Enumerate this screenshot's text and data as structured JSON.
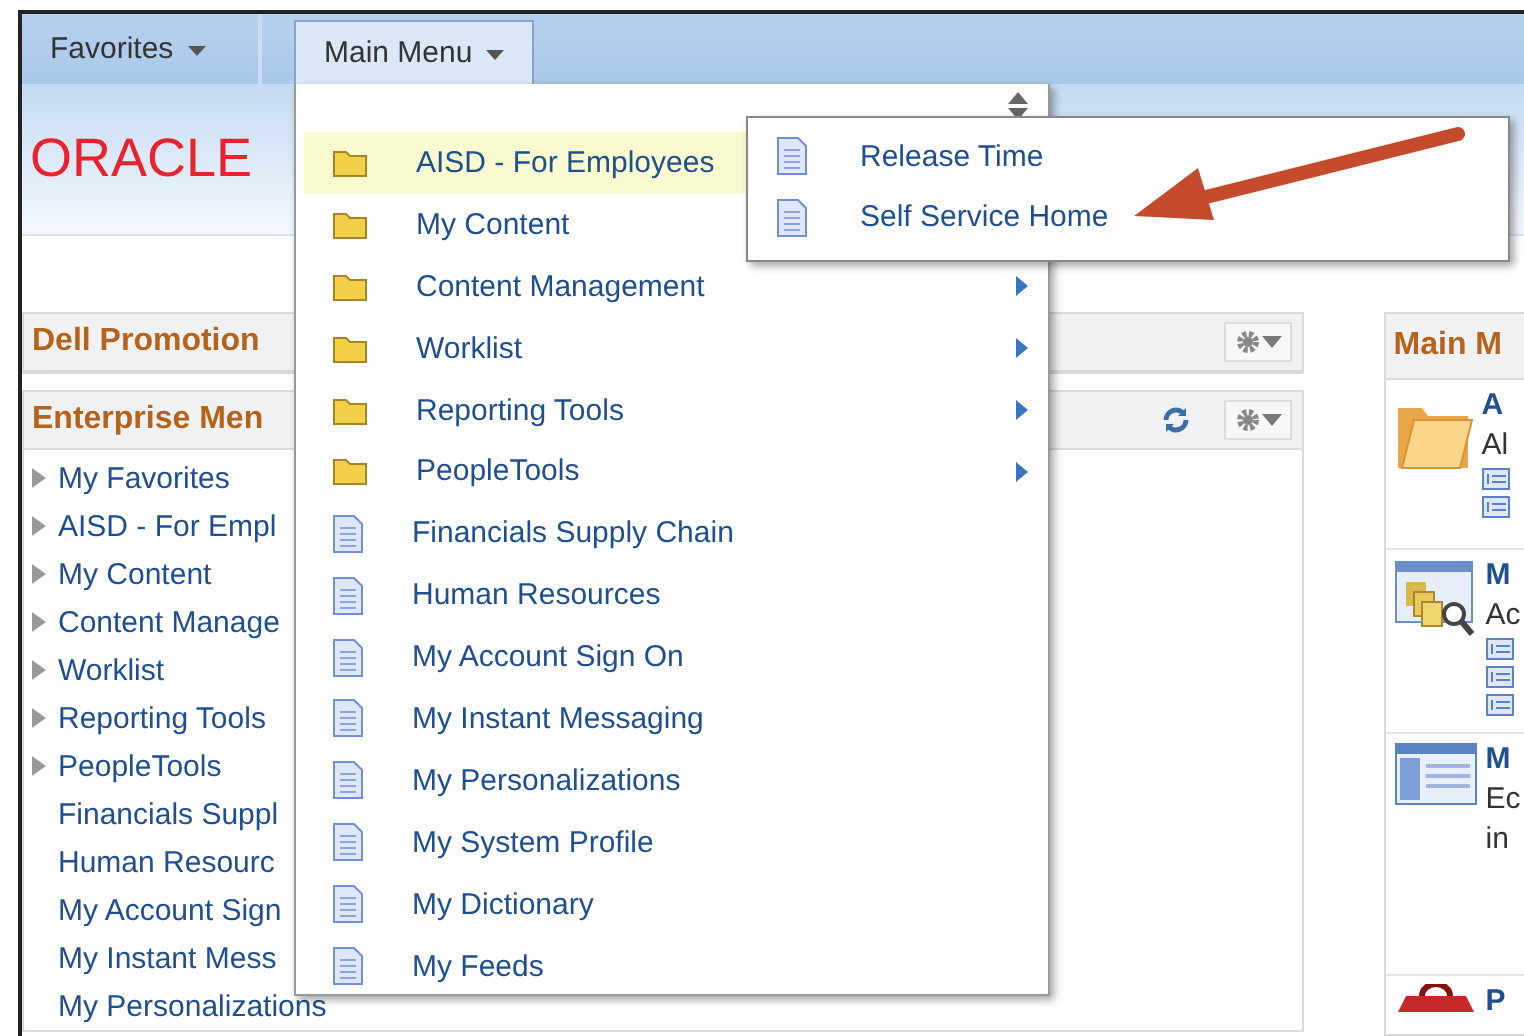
{
  "nav": {
    "tabs": [
      {
        "label": "Favorites",
        "selected": false
      },
      {
        "label": "Main Menu",
        "selected": true
      }
    ]
  },
  "header": {
    "logo": "ORACLE"
  },
  "pagelets": [
    {
      "title": "Dell Promotion",
      "refresh": false
    },
    {
      "title": "Enterprise Men",
      "refresh": true,
      "items": [
        {
          "label": "My Favorites",
          "expandable": true
        },
        {
          "label": "AISD - For Empl",
          "expandable": true
        },
        {
          "label": "My Content",
          "expandable": true
        },
        {
          "label": "Content Manage",
          "expandable": true
        },
        {
          "label": "Worklist",
          "expandable": true
        },
        {
          "label": "Reporting Tools",
          "expandable": true
        },
        {
          "label": "PeopleTools",
          "expandable": true
        },
        {
          "label": "Financials Suppl",
          "expandable": false
        },
        {
          "label": "Human Resourc",
          "expandable": false
        },
        {
          "label": "My Account Sign",
          "expandable": false
        },
        {
          "label": "My Instant Mess",
          "expandable": false
        },
        {
          "label": "My Personalizations",
          "expandable": false
        }
      ]
    }
  ],
  "main_menu_panel": {
    "title": "Main M",
    "sections": [
      {
        "kind": "folder",
        "title": "A",
        "lines": [
          {
            "kind": "text",
            "text": "Al"
          },
          {
            "kind": "link"
          },
          {
            "kind": "link"
          }
        ]
      },
      {
        "kind": "search-docs",
        "title": "M",
        "lines": [
          {
            "kind": "text",
            "text": "Ac"
          },
          {
            "kind": "link"
          },
          {
            "kind": "link"
          },
          {
            "kind": "link"
          }
        ]
      },
      {
        "kind": "window",
        "title": "M",
        "lines": [
          {
            "kind": "text",
            "text": "Ec"
          },
          {
            "kind": "text",
            "text": "in"
          }
        ]
      },
      {
        "kind": "toolbox",
        "title": "P"
      }
    ]
  },
  "dropdown": {
    "items": [
      {
        "label": "AISD - For Employees",
        "kind": "folder",
        "selected": true,
        "submenu": false
      },
      {
        "label": "My Content",
        "kind": "folder",
        "selected": false,
        "submenu": false
      },
      {
        "label": "Content Management",
        "kind": "folder",
        "selected": false,
        "submenu": true
      },
      {
        "label": "Worklist",
        "kind": "folder",
        "selected": false,
        "submenu": true
      },
      {
        "label": "Reporting Tools",
        "kind": "folder",
        "selected": false,
        "submenu": true
      },
      {
        "label": "PeopleTools",
        "kind": "folder",
        "selected": false,
        "submenu": true
      },
      {
        "label": "Financials Supply Chain",
        "kind": "page",
        "selected": false,
        "submenu": false
      },
      {
        "label": "Human Resources",
        "kind": "page",
        "selected": false,
        "submenu": false
      },
      {
        "label": "My Account Sign On",
        "kind": "page",
        "selected": false,
        "submenu": false
      },
      {
        "label": "My Instant Messaging",
        "kind": "page",
        "selected": false,
        "submenu": false
      },
      {
        "label": "My Personalizations",
        "kind": "page",
        "selected": false,
        "submenu": false
      },
      {
        "label": "My System Profile",
        "kind": "page",
        "selected": false,
        "submenu": false
      },
      {
        "label": "My Dictionary",
        "kind": "page",
        "selected": false,
        "submenu": false
      },
      {
        "label": "My Feeds",
        "kind": "page",
        "selected": false,
        "submenu": false
      }
    ]
  },
  "submenu": {
    "items": [
      {
        "label": "Release Time",
        "kind": "page",
        "selected": false
      },
      {
        "label": "Self Service Home",
        "kind": "page",
        "selected": false
      }
    ]
  }
}
